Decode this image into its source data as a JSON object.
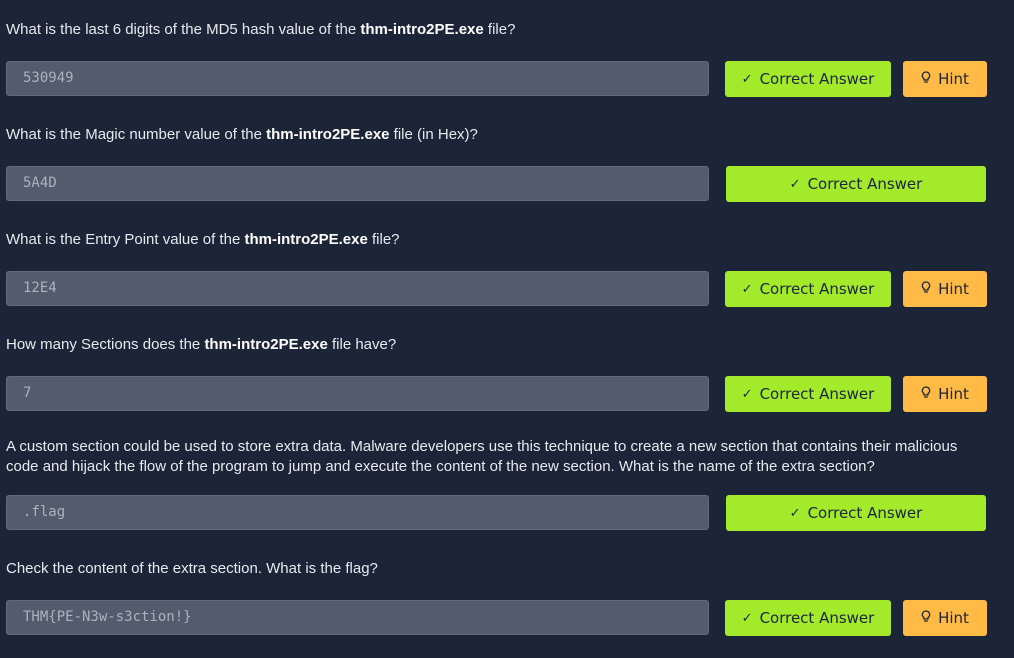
{
  "questions": [
    {
      "pre": "What is the last 6 digits of the MD5 hash value of the ",
      "bold": "thm-intro2PE.exe",
      "post": " file?",
      "answer": "530949",
      "correct_label": "Correct Answer",
      "hint_label": "Hint"
    },
    {
      "pre": "What is the Magic number value of the ",
      "bold": "thm-intro2PE.exe",
      "post": " file (in Hex)?",
      "answer": "5A4D",
      "correct_label": "Correct Answer"
    },
    {
      "pre": "What is the Entry Point value of the ",
      "bold": "thm-intro2PE.exe",
      "post": " file?",
      "answer": "12E4",
      "correct_label": "Correct Answer",
      "hint_label": "Hint"
    },
    {
      "pre": "How many Sections does the ",
      "bold": "thm-intro2PE.exe",
      "post": " file have?",
      "answer": "7",
      "correct_label": "Correct Answer",
      "hint_label": "Hint"
    },
    {
      "text": "A custom section could be used to store extra data. Malware developers use this technique to create a new section that contains their malicious code and hijack the flow of the program to jump and execute the content of the new section. What is the name of the extra section?",
      "answer": ".flag",
      "correct_label": "Correct Answer"
    },
    {
      "text": "Check the content of the extra section. What is the flag?",
      "answer": "THM{PE-N3w-s3ction!}",
      "correct_label": "Correct Answer",
      "hint_label": "Hint"
    }
  ],
  "icons": {
    "correct": "check-icon",
    "hint": "lightbulb-icon"
  },
  "colors": {
    "background": "#1c2538",
    "correct_button": "#a3ea2a",
    "hint_button": "#ffbb45",
    "answer_box": "#535c6d"
  }
}
